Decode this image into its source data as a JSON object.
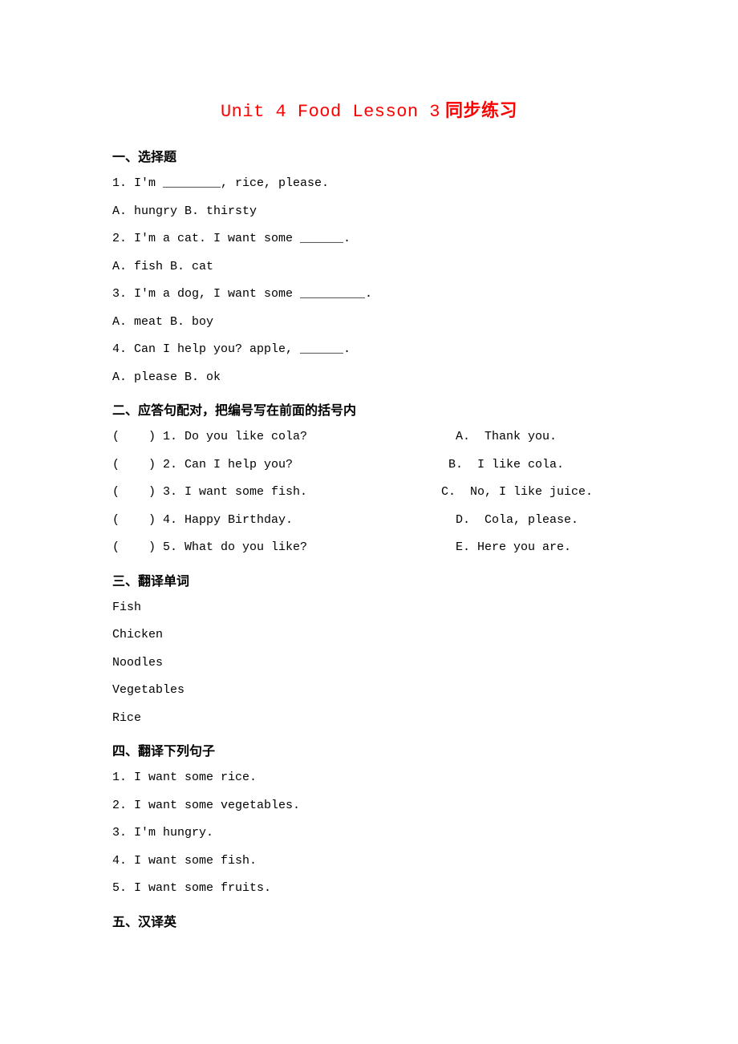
{
  "title_en": "Unit 4 Food Lesson 3",
  "title_cn": " 同步练习",
  "section1": {
    "heading": "一、选择题",
    "q1": "1. I'm ________, rice, please.",
    "q1_opts": "A. hungry        B. thirsty",
    "q2": "2. I'm a cat. I want some ______.",
    "q2_opts": "A. fish       B. cat",
    "q3": "3. I'm a dog, I want some _________.",
    "q3_opts": "A. meat          B. boy",
    "q4": "4. Can I help you? apple, ______.",
    "q4_opts": "A. please         B. ok"
  },
  "section2": {
    "heading": "二、应答句配对，把编号写在前面的括号内",
    "rows": [
      {
        "left": "(    ) 1. Do you like cola?",
        "right": "  A.  Thank you."
      },
      {
        "left": "(    ) 2. Can I help you?",
        "right": " B.  I like cola."
      },
      {
        "left": "(    ) 3. I want some fish.",
        "right": "C.  No, I like juice."
      },
      {
        "left": "(    ) 4. Happy Birthday.",
        "right": "  D.  Cola, please."
      },
      {
        "left": "(    ) 5. What do you like?",
        "right": "  E. Here you are."
      }
    ]
  },
  "section3": {
    "heading": "三、翻译单词",
    "w1": "Fish",
    "w2": "Chicken",
    "w3": "Noodles",
    "w4": "Vegetables",
    "w5": "Rice"
  },
  "section4": {
    "heading": "四、翻译下列句子",
    "s1": "1. I want some rice.",
    "s2": "2. I want some vegetables.",
    "s3": "3. I'm hungry.",
    "s4": "4. I want some fish.",
    "s5": "5. I want some fruits."
  },
  "section5": {
    "heading": "五、汉译英"
  }
}
